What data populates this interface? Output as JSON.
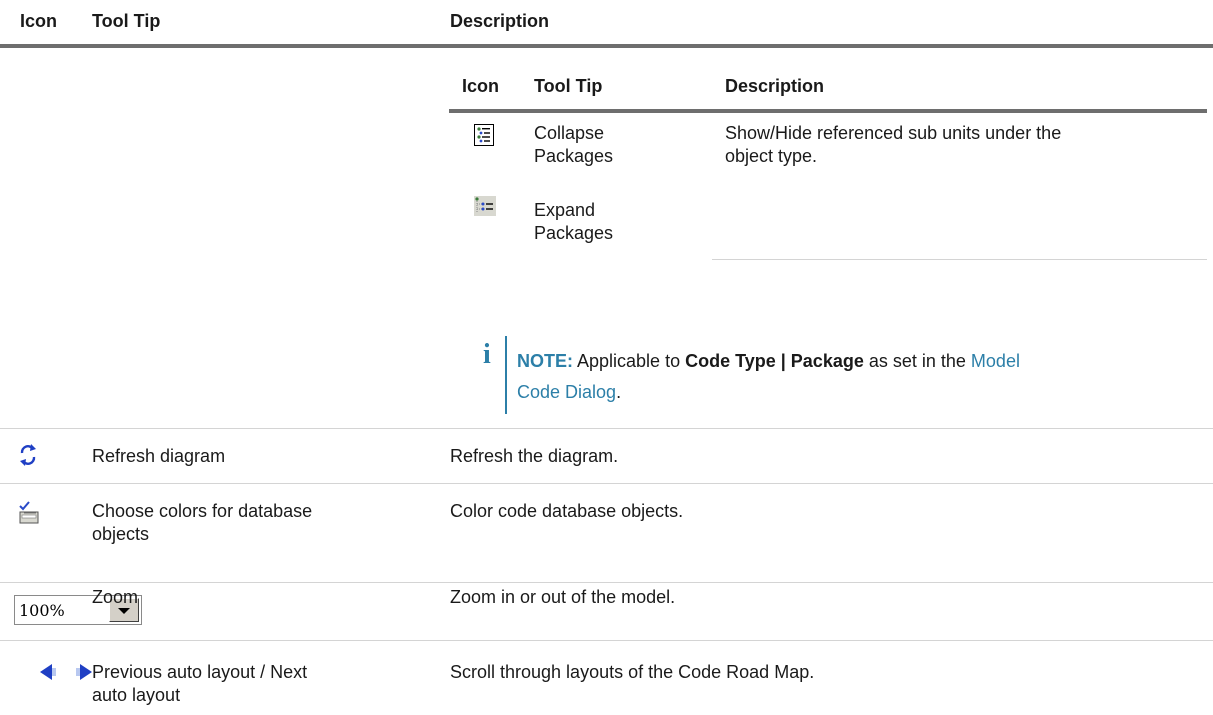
{
  "outer_table": {
    "headers": {
      "icon": "Icon",
      "tooltip": "Tool Tip",
      "description": "Description"
    },
    "rows": [
      {
        "icon": "refresh-diagram-icon",
        "tooltip": "Refresh diagram",
        "description": "Refresh the diagram."
      },
      {
        "icon": "color-objects-icon",
        "tooltip_line1": "Choose colors for database",
        "tooltip_line2": "objects",
        "description": "Color code database objects."
      },
      {
        "icon": "zoom-select-icon",
        "zoom_value": "100%",
        "tooltip": "Zoom",
        "description": "Zoom in or out of the model."
      },
      {
        "icon": "prev-next-arrows-icon",
        "tooltip_line1": "Previous auto layout / Next",
        "tooltip_line2": "auto layout",
        "description": "Scroll through layouts of the Code Road Map."
      }
    ]
  },
  "inner_table": {
    "headers": {
      "icon": "Icon",
      "tooltip": "Tool Tip",
      "description": "Description"
    },
    "rows": [
      {
        "icon": "collapse-packages-icon",
        "tooltip_line1": "Collapse",
        "tooltip_line2": "Packages"
      },
      {
        "icon": "expand-packages-icon",
        "tooltip_line1": "Expand",
        "tooltip_line2": "Packages"
      }
    ],
    "description_line1": "Show/Hide referenced sub units under the",
    "description_line2": "object type."
  },
  "note": {
    "icon": "info-icon",
    "label": "NOTE:",
    "text1": " Applicable to ",
    "bold": "Code Type | Package",
    "text2": " as set in the ",
    "link_line1": "Model",
    "link_line2": "Code Dialog",
    "end": "."
  },
  "colors": {
    "accent": "#2c7fa8",
    "rule": "#6e6e6e",
    "icon_blue": "#1f3fc4"
  }
}
